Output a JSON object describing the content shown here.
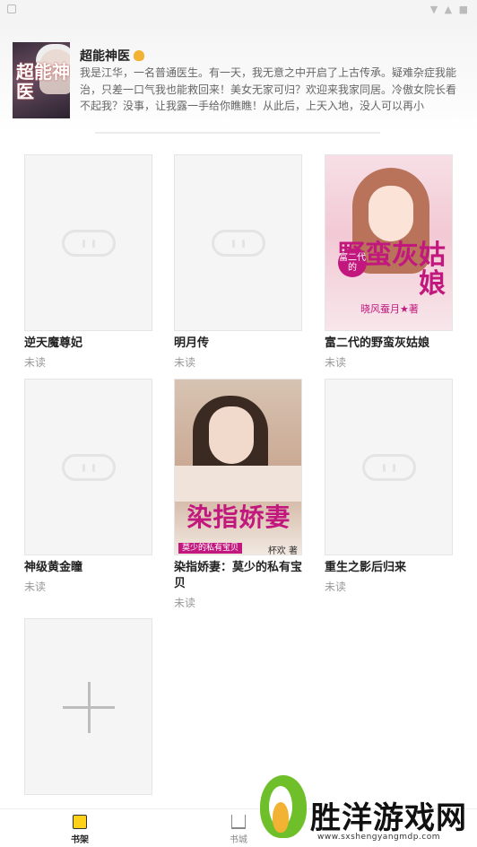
{
  "status_bar": {
    "right_icons": "▼ ▲ ■"
  },
  "featured": {
    "cover_text": "超能神医",
    "title": "超能神医",
    "title_icon": "hand-icon",
    "description": "我是江华，一名普通医生。有一天，我无意之中开启了上古传承。疑难杂症我能治，只差一口气我也能救回来！美女无家可归？欢迎来我家同居。冷傲女院长看不起我？没事，让我露一手给你瞧瞧！从此后，上天入地，没人可以再小"
  },
  "books": [
    {
      "title": "逆天魔尊妃",
      "status": "未读",
      "cover": "placeholder"
    },
    {
      "title": "明月传",
      "status": "未读",
      "cover": "placeholder"
    },
    {
      "title": "富二代的野蛮灰姑娘",
      "status": "未读",
      "cover": "pink",
      "cover_title": "野蛮灰姑娘",
      "cover_badge": "富二代的",
      "cover_author": "晓风蚕月★著"
    },
    {
      "title": "神级黄金瞳",
      "status": "未读",
      "cover": "placeholder"
    },
    {
      "title": "染指娇妻：莫少的私有宝贝",
      "status": "未读",
      "cover": "woman",
      "cover_title": "染指娇妻",
      "cover_subtitle": "莫少的私有宝贝",
      "cover_author": "杯欢 著"
    },
    {
      "title": "重生之影后归来",
      "status": "未读",
      "cover": "placeholder"
    }
  ],
  "add_card": {
    "icon": "plus-icon"
  },
  "bottom_nav": [
    {
      "label": "书架",
      "icon": "bookshelf-icon",
      "active": true
    },
    {
      "label": "书城",
      "icon": "bookstore-icon",
      "active": false
    }
  ],
  "watermark": {
    "text": "胜洋游戏网",
    "url": "www.sxshengyangmdp.com"
  }
}
